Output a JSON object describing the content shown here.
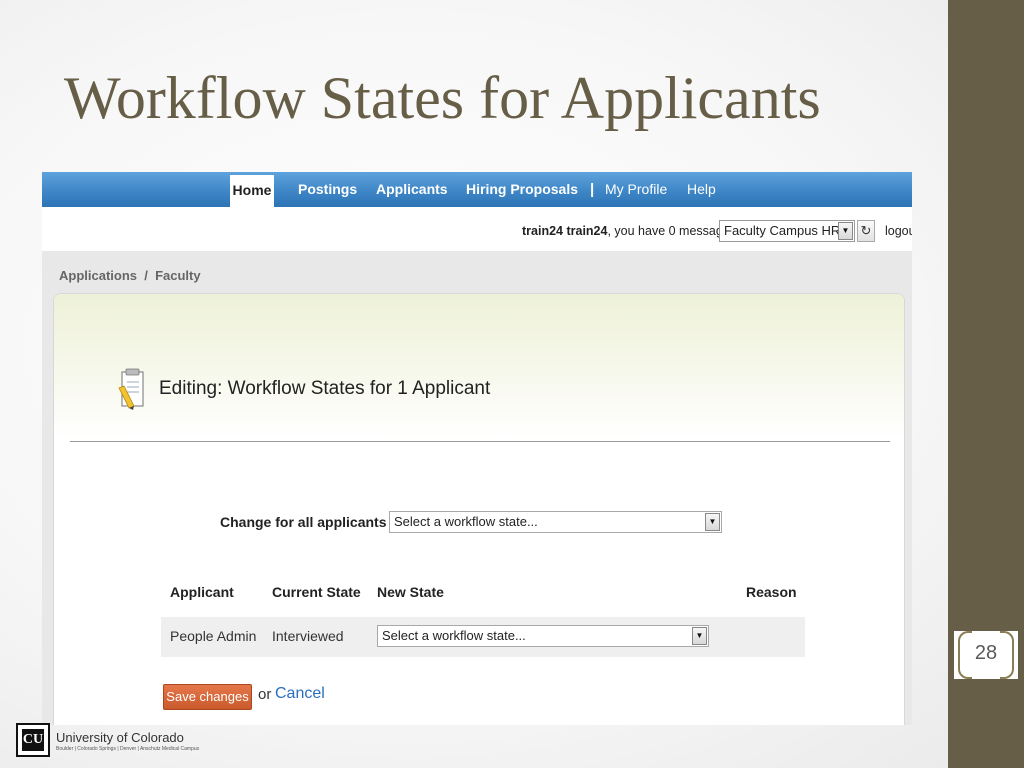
{
  "slide": {
    "title": "Workflow States for Applicants",
    "page_number": "28",
    "colors": {
      "accent": "#675e47",
      "nav_blue": "#3e86c6",
      "save_orange": "#d4643a",
      "link_blue": "#2a6fbf"
    }
  },
  "app": {
    "nav": {
      "home": "Home",
      "postings": "Postings",
      "applicants": "Applicants",
      "hiring_proposals": "Hiring Proposals",
      "separator": "|",
      "my_profile": "My Profile",
      "help": "Help"
    },
    "userbar": {
      "username": "train24 train24",
      "message_suffix": ", you have 0 messages.",
      "role_select_value": "Faculty Campus HR",
      "refresh_icon": "refresh-icon",
      "logout": "logou"
    },
    "breadcrumb": "Applications  /  Faculty",
    "editing_title": "Editing: Workflow States for 1 Applicant",
    "document_icon": "edit-document-icon",
    "change_all_label": "Change for all applicants",
    "change_all_select": "Select a workflow state...",
    "table": {
      "headers": {
        "applicant": "Applicant",
        "current_state": "Current State",
        "new_state": "New State",
        "reason": "Reason"
      },
      "rows": [
        {
          "applicant": "People Admin",
          "current_state": "Interviewed",
          "new_state": "Select a workflow state..."
        }
      ]
    },
    "actions": {
      "save": "Save changes",
      "or": "or",
      "cancel": "Cancel"
    }
  },
  "footer": {
    "logo_letters": "CU",
    "org_name": "University of Colorado",
    "campuses": "Boulder | Colorado Springs | Denver | Anschutz Medical Campus"
  }
}
